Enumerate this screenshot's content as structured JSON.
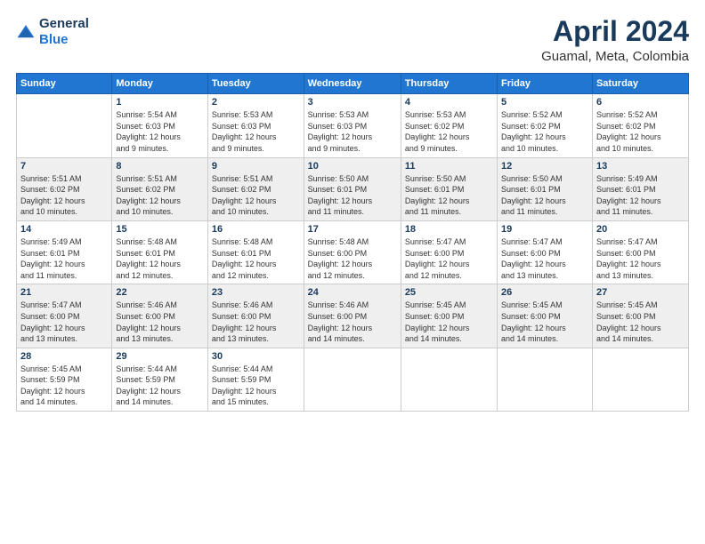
{
  "header": {
    "logo_line1": "General",
    "logo_line2": "Blue",
    "month": "April 2024",
    "location": "Guamal, Meta, Colombia"
  },
  "days_of_week": [
    "Sunday",
    "Monday",
    "Tuesday",
    "Wednesday",
    "Thursday",
    "Friday",
    "Saturday"
  ],
  "weeks": [
    [
      {
        "day": "",
        "info": ""
      },
      {
        "day": "1",
        "info": "Sunrise: 5:54 AM\nSunset: 6:03 PM\nDaylight: 12 hours\nand 9 minutes."
      },
      {
        "day": "2",
        "info": "Sunrise: 5:53 AM\nSunset: 6:03 PM\nDaylight: 12 hours\nand 9 minutes."
      },
      {
        "day": "3",
        "info": "Sunrise: 5:53 AM\nSunset: 6:03 PM\nDaylight: 12 hours\nand 9 minutes."
      },
      {
        "day": "4",
        "info": "Sunrise: 5:53 AM\nSunset: 6:02 PM\nDaylight: 12 hours\nand 9 minutes."
      },
      {
        "day": "5",
        "info": "Sunrise: 5:52 AM\nSunset: 6:02 PM\nDaylight: 12 hours\nand 10 minutes."
      },
      {
        "day": "6",
        "info": "Sunrise: 5:52 AM\nSunset: 6:02 PM\nDaylight: 12 hours\nand 10 minutes."
      }
    ],
    [
      {
        "day": "7",
        "info": "Sunrise: 5:51 AM\nSunset: 6:02 PM\nDaylight: 12 hours\nand 10 minutes."
      },
      {
        "day": "8",
        "info": "Sunrise: 5:51 AM\nSunset: 6:02 PM\nDaylight: 12 hours\nand 10 minutes."
      },
      {
        "day": "9",
        "info": "Sunrise: 5:51 AM\nSunset: 6:02 PM\nDaylight: 12 hours\nand 10 minutes."
      },
      {
        "day": "10",
        "info": "Sunrise: 5:50 AM\nSunset: 6:01 PM\nDaylight: 12 hours\nand 11 minutes."
      },
      {
        "day": "11",
        "info": "Sunrise: 5:50 AM\nSunset: 6:01 PM\nDaylight: 12 hours\nand 11 minutes."
      },
      {
        "day": "12",
        "info": "Sunrise: 5:50 AM\nSunset: 6:01 PM\nDaylight: 12 hours\nand 11 minutes."
      },
      {
        "day": "13",
        "info": "Sunrise: 5:49 AM\nSunset: 6:01 PM\nDaylight: 12 hours\nand 11 minutes."
      }
    ],
    [
      {
        "day": "14",
        "info": "Sunrise: 5:49 AM\nSunset: 6:01 PM\nDaylight: 12 hours\nand 11 minutes."
      },
      {
        "day": "15",
        "info": "Sunrise: 5:48 AM\nSunset: 6:01 PM\nDaylight: 12 hours\nand 12 minutes."
      },
      {
        "day": "16",
        "info": "Sunrise: 5:48 AM\nSunset: 6:01 PM\nDaylight: 12 hours\nand 12 minutes."
      },
      {
        "day": "17",
        "info": "Sunrise: 5:48 AM\nSunset: 6:00 PM\nDaylight: 12 hours\nand 12 minutes."
      },
      {
        "day": "18",
        "info": "Sunrise: 5:47 AM\nSunset: 6:00 PM\nDaylight: 12 hours\nand 12 minutes."
      },
      {
        "day": "19",
        "info": "Sunrise: 5:47 AM\nSunset: 6:00 PM\nDaylight: 12 hours\nand 13 minutes."
      },
      {
        "day": "20",
        "info": "Sunrise: 5:47 AM\nSunset: 6:00 PM\nDaylight: 12 hours\nand 13 minutes."
      }
    ],
    [
      {
        "day": "21",
        "info": "Sunrise: 5:47 AM\nSunset: 6:00 PM\nDaylight: 12 hours\nand 13 minutes."
      },
      {
        "day": "22",
        "info": "Sunrise: 5:46 AM\nSunset: 6:00 PM\nDaylight: 12 hours\nand 13 minutes."
      },
      {
        "day": "23",
        "info": "Sunrise: 5:46 AM\nSunset: 6:00 PM\nDaylight: 12 hours\nand 13 minutes."
      },
      {
        "day": "24",
        "info": "Sunrise: 5:46 AM\nSunset: 6:00 PM\nDaylight: 12 hours\nand 14 minutes."
      },
      {
        "day": "25",
        "info": "Sunrise: 5:45 AM\nSunset: 6:00 PM\nDaylight: 12 hours\nand 14 minutes."
      },
      {
        "day": "26",
        "info": "Sunrise: 5:45 AM\nSunset: 6:00 PM\nDaylight: 12 hours\nand 14 minutes."
      },
      {
        "day": "27",
        "info": "Sunrise: 5:45 AM\nSunset: 6:00 PM\nDaylight: 12 hours\nand 14 minutes."
      }
    ],
    [
      {
        "day": "28",
        "info": "Sunrise: 5:45 AM\nSunset: 5:59 PM\nDaylight: 12 hours\nand 14 minutes."
      },
      {
        "day": "29",
        "info": "Sunrise: 5:44 AM\nSunset: 5:59 PM\nDaylight: 12 hours\nand 14 minutes."
      },
      {
        "day": "30",
        "info": "Sunrise: 5:44 AM\nSunset: 5:59 PM\nDaylight: 12 hours\nand 15 minutes."
      },
      {
        "day": "",
        "info": ""
      },
      {
        "day": "",
        "info": ""
      },
      {
        "day": "",
        "info": ""
      },
      {
        "day": "",
        "info": ""
      }
    ]
  ]
}
